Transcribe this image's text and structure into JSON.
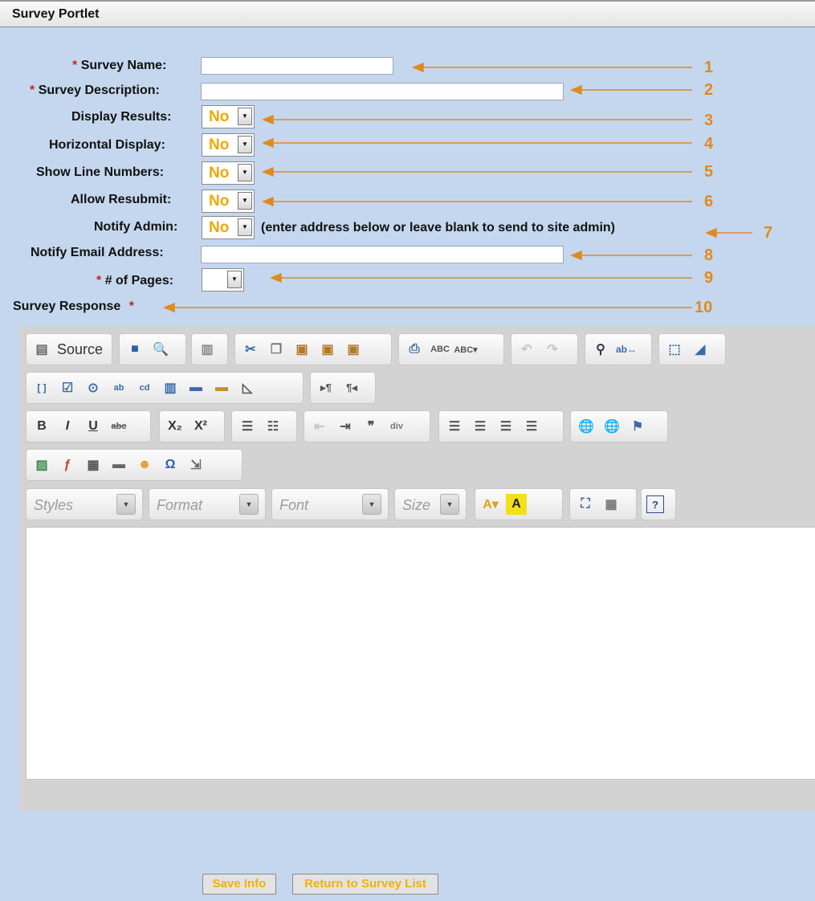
{
  "portlet_title": "Survey Portlet",
  "required_marker": "*",
  "fields": {
    "survey_name": {
      "label": "Survey Name:",
      "value": ""
    },
    "survey_description": {
      "label": "Survey Description:",
      "value": ""
    },
    "display_results": {
      "label": "Display Results:",
      "value": "No"
    },
    "horizontal_display": {
      "label": "Horizontal Display:",
      "value": "No"
    },
    "show_line_numbers": {
      "label": "Show Line Numbers:",
      "value": "No"
    },
    "allow_resubmit": {
      "label": "Allow Resubmit:",
      "value": "No"
    },
    "notify_admin": {
      "label": "Notify Admin:",
      "value": "No",
      "note": "(enter address below or leave blank to send to site admin)"
    },
    "notify_email": {
      "label": "Notify Email Address:",
      "value": ""
    },
    "num_pages": {
      "label": "# of Pages:",
      "value": ""
    },
    "survey_response": {
      "label": "Survey Response"
    }
  },
  "callouts": [
    "1",
    "2",
    "3",
    "4",
    "5",
    "6",
    "7",
    "8",
    "9",
    "10"
  ],
  "editor": {
    "source_label": "Source",
    "combos": {
      "styles": "Styles",
      "format": "Format",
      "font": "Font",
      "size": "Size"
    },
    "content": ""
  },
  "buttons": {
    "save": "Save Info",
    "return": "Return to Survey List"
  },
  "colors": {
    "background": "#c5d7ee",
    "accent": "#e08a1e",
    "select_value": "#f0a800",
    "required": "#cc2222"
  }
}
